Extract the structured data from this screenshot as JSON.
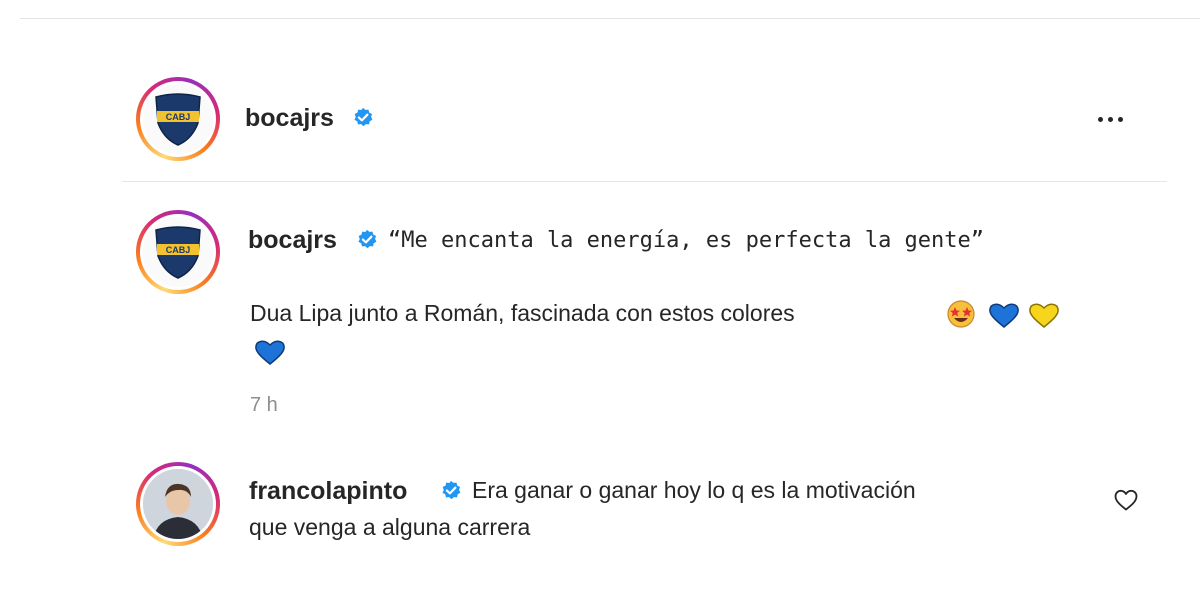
{
  "post": {
    "author": "bocajrs",
    "more_label": "more-options"
  },
  "caption": {
    "author": "bocajrs",
    "quote": "“Me encanta la energía, es perfecta la gente”",
    "text": "Dua Lipa junto a Román, fascinada con estos colores",
    "emojis": [
      "star-struck-emoji",
      "blue-heart-emoji",
      "yellow-heart-emoji",
      "blue-heart-emoji"
    ],
    "time": "7 h"
  },
  "comment": {
    "author": "francolapinto",
    "line1": "Era ganar o ganar hoy lo q es la motivación",
    "line2": "que venga a alguna carrera"
  },
  "logo": {
    "text": "CABJ"
  },
  "colors": {
    "verified": "#2196f3",
    "boca_blue": "#1b3a6b",
    "boca_gold": "#f2c230",
    "heart_blue": "#1e73d8",
    "heart_yellow": "#f7d51c"
  }
}
